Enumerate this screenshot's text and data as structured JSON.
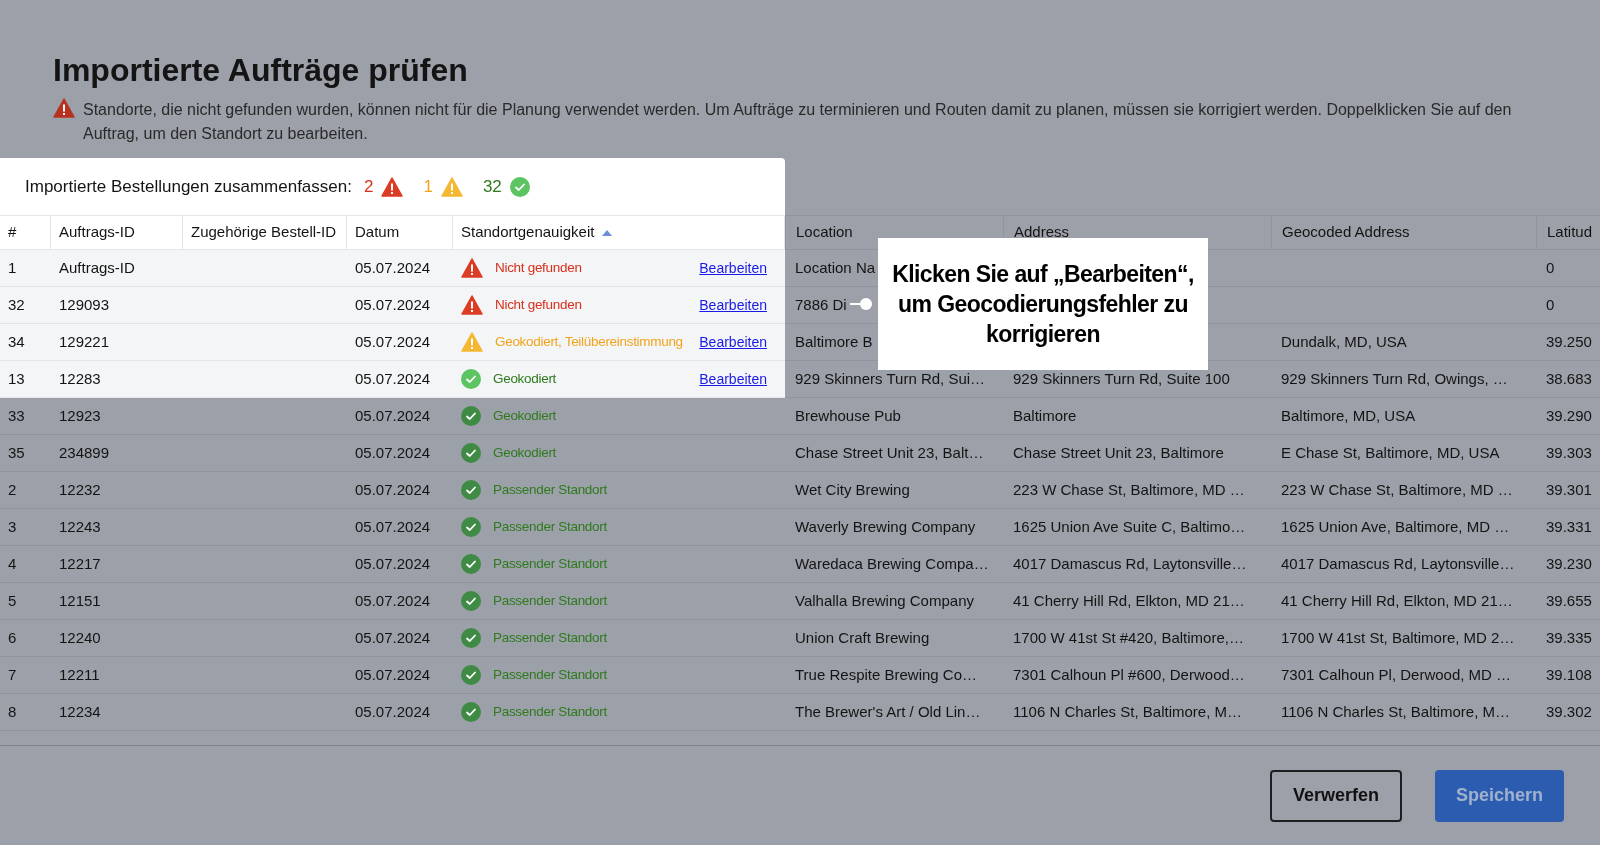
{
  "title": "Importierte Aufträge prüfen",
  "notice": "Standorte, die nicht gefunden wurden, können nicht für die Planung verwendet werden. Um Aufträge zu terminieren und Routen damit zu planen, müssen sie korrigiert werden. Doppelklicken Sie auf den Auftrag, um den Standort zu bearbeiten.",
  "summary": {
    "label": "Importierte Bestellungen zusammenfassen:",
    "counts": [
      {
        "kind": "error",
        "count": "2"
      },
      {
        "kind": "warning",
        "count": "1"
      },
      {
        "kind": "ok",
        "count": "32"
      }
    ]
  },
  "columns": [
    {
      "label": "#",
      "sorted": false
    },
    {
      "label": "Auftrags-ID",
      "sorted": false
    },
    {
      "label": "Zugehörige Bestell-ID",
      "sorted": false
    },
    {
      "label": "Datum",
      "sorted": false
    },
    {
      "label": "Standortgenauigkeit",
      "sorted": true
    },
    {
      "label": "Location",
      "sorted": false
    },
    {
      "label": "Address",
      "sorted": false
    },
    {
      "label": "Geocoded Address",
      "sorted": false
    },
    {
      "label": "Latitud",
      "sorted": false
    }
  ],
  "rows": [
    {
      "spotlighted": true,
      "number": "1",
      "order_id": "Auftrags-ID",
      "date": "05.07.2024",
      "status": {
        "kind": "error",
        "label": "Nicht gefunden"
      },
      "edit_link": "Bearbeiten",
      "location": "Location Na",
      "latitude": "0"
    },
    {
      "spotlighted": true,
      "number": "32",
      "order_id": "129093",
      "date": "05.07.2024",
      "status": {
        "kind": "error",
        "label": "Nicht gefunden"
      },
      "edit_link": "Bearbeiten",
      "location": "7886 Di",
      "latitude": "0"
    },
    {
      "spotlighted": true,
      "number": "34",
      "order_id": "129221",
      "date": "05.07.2024",
      "status": {
        "kind": "warning",
        "label": "Geokodiert, Teilübereinstimmung"
      },
      "edit_link": "Bearbeiten",
      "location": "Baltimore B",
      "geocoded_address": "Dundalk, MD, USA",
      "latitude": "39.250"
    },
    {
      "spotlighted": true,
      "number": "13",
      "order_id": "12283",
      "date": "05.07.2024",
      "status": {
        "kind": "ok",
        "label": "Geokodiert"
      },
      "edit_link": "Bearbeiten",
      "location": "929 Skinners Turn Rd, Sui…",
      "address": "929 Skinners Turn Rd, Suite 100",
      "geocoded_address": "929 Skinners Turn Rd, Owings, …",
      "latitude": "38.683"
    },
    {
      "spotlighted": false,
      "number": "33",
      "order_id": "12923",
      "date": "05.07.2024",
      "status": {
        "kind": "ok",
        "label": "Geokodiert"
      },
      "location": "Brewhouse Pub",
      "address": "Baltimore",
      "geocoded_address": "Baltimore, MD, USA",
      "latitude": "39.290"
    },
    {
      "spotlighted": false,
      "number": "35",
      "order_id": "234899",
      "date": "05.07.2024",
      "status": {
        "kind": "ok",
        "label": "Geokodiert"
      },
      "location": "Chase Street Unit 23, Balt…",
      "address": "Chase Street Unit 23, Baltimore",
      "geocoded_address": "E Chase St, Baltimore, MD, USA",
      "latitude": "39.303"
    },
    {
      "spotlighted": false,
      "number": "2",
      "order_id": "12232",
      "date": "05.07.2024",
      "status": {
        "kind": "match",
        "label": "Passender Standort"
      },
      "location": "Wet City Brewing",
      "address": "223 W Chase St, Baltimore, MD …",
      "geocoded_address": "223 W Chase St, Baltimore, MD …",
      "latitude": "39.301"
    },
    {
      "spotlighted": false,
      "number": "3",
      "order_id": "12243",
      "date": "05.07.2024",
      "status": {
        "kind": "match",
        "label": "Passender Standort"
      },
      "location": "Waverly Brewing Company",
      "address": "1625 Union Ave Suite C, Baltimo…",
      "geocoded_address": "1625 Union Ave, Baltimore, MD …",
      "latitude": "39.331"
    },
    {
      "spotlighted": false,
      "number": "4",
      "order_id": "12217",
      "date": "05.07.2024",
      "status": {
        "kind": "match",
        "label": "Passender Standort"
      },
      "location": "Waredaca Brewing Compa…",
      "address": "4017 Damascus Rd, Laytonsville…",
      "geocoded_address": "4017 Damascus Rd, Laytonsville…",
      "latitude": "39.230"
    },
    {
      "spotlighted": false,
      "number": "5",
      "order_id": "12151",
      "date": "05.07.2024",
      "status": {
        "kind": "match",
        "label": "Passender Standort"
      },
      "location": "Valhalla Brewing Company",
      "address": "41 Cherry Hill Rd, Elkton, MD 21…",
      "geocoded_address": "41 Cherry Hill Rd, Elkton, MD 21…",
      "latitude": "39.655"
    },
    {
      "spotlighted": false,
      "number": "6",
      "order_id": "12240",
      "date": "05.07.2024",
      "status": {
        "kind": "match",
        "label": "Passender Standort"
      },
      "location": "Union Craft Brewing",
      "address": "1700 W 41st St #420, Baltimore,…",
      "geocoded_address": "1700 W 41st St, Baltimore, MD 2…",
      "latitude": "39.335"
    },
    {
      "spotlighted": false,
      "number": "7",
      "order_id": "12211",
      "date": "05.07.2024",
      "status": {
        "kind": "match",
        "label": "Passender Standort"
      },
      "location": "True Respite Brewing Co…",
      "address": "7301 Calhoun Pl #600, Derwood…",
      "geocoded_address": "7301 Calhoun Pl, Derwood, MD …",
      "latitude": "39.108"
    },
    {
      "spotlighted": false,
      "number": "8",
      "order_id": "12234",
      "date": "05.07.2024",
      "status": {
        "kind": "match",
        "label": "Passender Standort"
      },
      "location": "The Brewer's Art / Old Lin…",
      "address": "1106 N Charles St, Baltimore, M…",
      "geocoded_address": "1106 N Charles St, Baltimore, M…",
      "latitude": "39.302"
    }
  ],
  "callout": {
    "text": "Klicken Sie auf „Bearbeiten“, um Geocodierungsfehler zu korrigieren"
  },
  "buttons": [
    {
      "kind": "secondary",
      "label": "Verwerfen"
    },
    {
      "kind": "primary",
      "label": "Speichern"
    }
  ]
}
